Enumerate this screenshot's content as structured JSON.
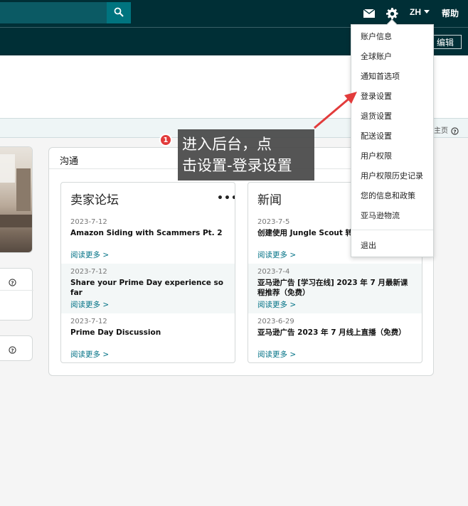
{
  "header": {
    "search_icon": "search-icon",
    "mail_icon": "mail-icon",
    "gear_icon": "gear-icon",
    "language": "ZH",
    "help": "帮助"
  },
  "navbar": {
    "edit": "编辑"
  },
  "notice": {
    "homepage_link": "主页"
  },
  "communication": {
    "title": "沟通",
    "forum": {
      "title": "卖家论坛",
      "menu": "•••",
      "items": [
        {
          "date": "2023-7-12",
          "title": "Amazon Siding with Scammers Pt. 2",
          "link": "阅读更多 >"
        },
        {
          "date": "2023-7-12",
          "title": "Share your Prime Day experience so far",
          "link": "阅读更多 >"
        },
        {
          "date": "2023-7-12",
          "title": "Prime Day Discussion",
          "link": "阅读更多 >"
        }
      ]
    },
    "news": {
      "title": "新闻",
      "items": [
        {
          "date": "2023-7-5",
          "title": "创建使用 Jungle Scout 转",
          "link": "阅读更多 >"
        },
        {
          "date": "2023-7-4",
          "title": "亚马逊广告 [学习在线] 2023 年 7 月最新课程推荐（免费）",
          "link": "阅读更多 >"
        },
        {
          "date": "2023-6-29",
          "title": "亚马逊广告 2023 年 7 月线上直播（免费）",
          "link": "阅读更多 >"
        }
      ]
    }
  },
  "settings_menu": {
    "items": [
      "账户信息",
      "全球账户",
      "通知首选项",
      "登录设置",
      "退货设置",
      "配送设置",
      "用户权限",
      "用户权限历史记录",
      "您的信息和政策",
      "亚马逊物流"
    ],
    "logout": "退出"
  },
  "annotation": {
    "step": "1",
    "line1": "进入后台，点",
    "line2": "击设置-登录设置"
  },
  "colors": {
    "header_bg": "#002f36",
    "link": "#007185",
    "badge": "#e23b3b"
  }
}
